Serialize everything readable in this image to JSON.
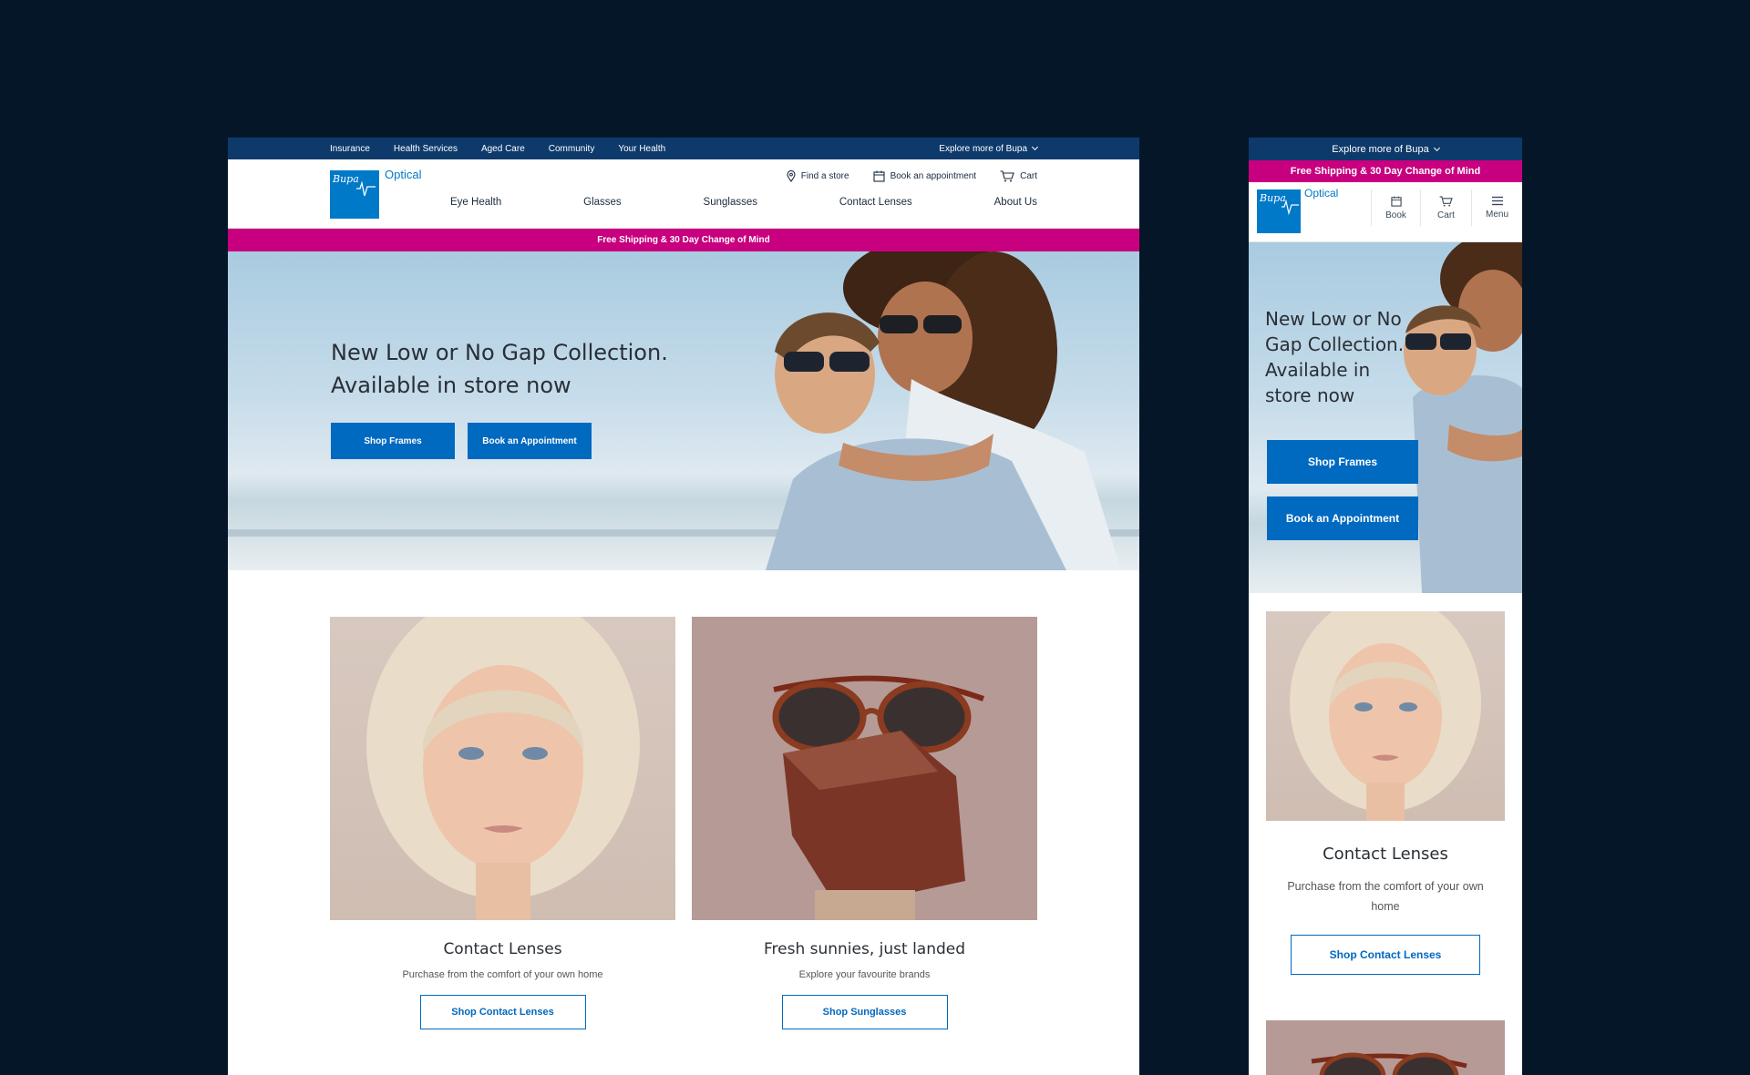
{
  "desktop": {
    "utility_links": [
      "Insurance",
      "Health Services",
      "Aged Care",
      "Community",
      "Your Health"
    ],
    "explore_label": "Explore more of Bupa",
    "brand": {
      "bupa": "Bupa",
      "optical": "Optical"
    },
    "service_links": {
      "find_store": "Find a store",
      "book": "Book an appointment",
      "cart": "Cart"
    },
    "nav": [
      "Eye Health",
      "Glasses",
      "Sunglasses",
      "Contact Lenses",
      "About Us"
    ],
    "promo": "Free Shipping & 30 Day Change of Mind",
    "hero": {
      "title": "New Low or No Gap Collection. Available in store now",
      "primary_cta": "Shop Frames",
      "secondary_cta": "Book an Appointment"
    },
    "cards": [
      {
        "title": "Contact Lenses",
        "text": "Purchase from the comfort of your own home",
        "cta": "Shop Contact Lenses"
      },
      {
        "title": "Fresh sunnies, just landed",
        "text": "Explore your favourite brands",
        "cta": "Shop Sunglasses"
      }
    ]
  },
  "mobile": {
    "explore_label": "Explore more of Bupa",
    "promo": "Free Shipping & 30 Day Change of Mind",
    "brand": {
      "bupa": "Bupa",
      "optical": "Optical"
    },
    "actions": [
      "Book",
      "Cart",
      "Menu"
    ],
    "hero": {
      "title": "New Low or No Gap Collection. Available in store now",
      "primary_cta": "Shop Frames",
      "secondary_cta": "Book an Appointment"
    },
    "card": {
      "title": "Contact Lenses",
      "text": "Purchase from the comfort of your own home",
      "cta": "Shop Contact Lenses"
    }
  },
  "colors": {
    "background": "#061629",
    "utility_bar": "#0d3a6b",
    "brand_blue": "#0079c8",
    "button_blue": "#0069c0",
    "promo_magenta": "#c8007f"
  },
  "icons": [
    "location-pin-icon",
    "calendar-icon",
    "cart-icon",
    "menu-icon",
    "chevron-down-icon"
  ]
}
